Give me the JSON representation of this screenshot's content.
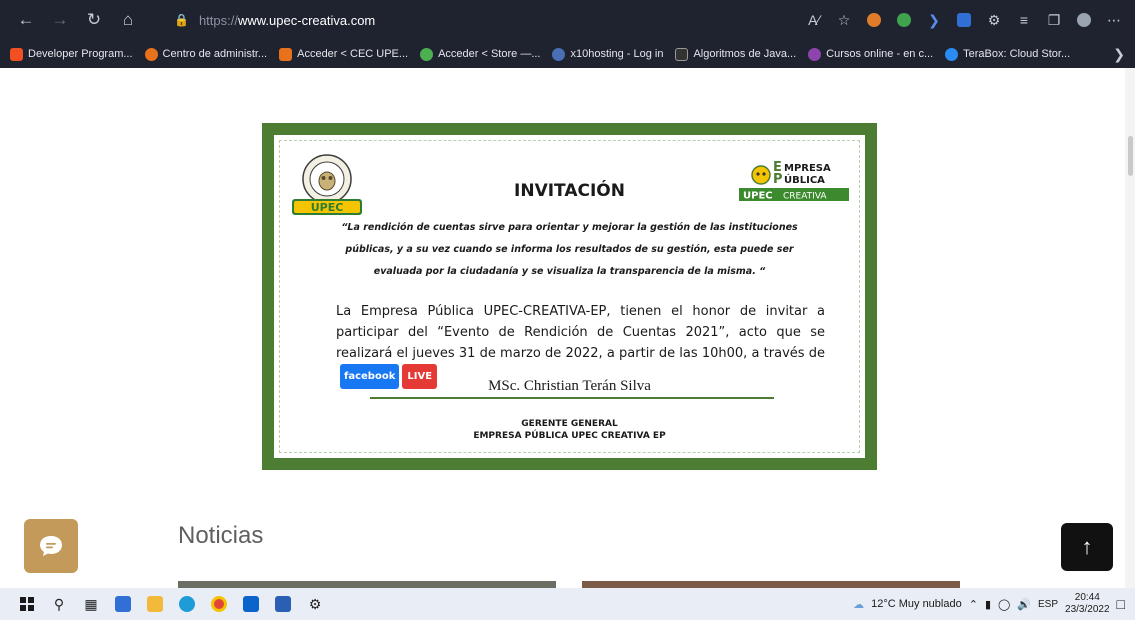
{
  "browser": {
    "url_scheme": "https://",
    "url_host": "www.upec-creativa.com",
    "bookmarks": [
      {
        "label": "Developer Program...",
        "color": "#f25022"
      },
      {
        "label": "Centro de administr...",
        "color": "#e8711c"
      },
      {
        "label": "Acceder < CEC UPE...",
        "color": "#e8711c"
      },
      {
        "label": "Acceder < Store —...",
        "color": "#4caf50"
      },
      {
        "label": "x10hosting - Log in",
        "color": "#4a6fb5"
      },
      {
        "label": "Algoritmos de Java...",
        "color": "#333333"
      },
      {
        "label": "Cursos online - en c...",
        "color": "#8e44ad"
      },
      {
        "label": "TeraBox: Cloud Stor...",
        "color": "#2a8bf2"
      }
    ]
  },
  "invitation": {
    "left_logo_text": "UPEC",
    "right_logo_lines": [
      "MPRESA",
      "ÚBLICA"
    ],
    "right_logo_caps": [
      "E",
      "P"
    ],
    "right_logo_bar": "UPEC",
    "right_logo_bar2": "CREATIVA",
    "title": "INVITACIÓN",
    "quote_lines": [
      "“La rendición de cuentas sirve para orientar y mejorar la gestión de las instituciones",
      "públicas, y a su vez cuando se informa los resultados de su gestión, esta puede ser",
      "evaluada por la ciudadanía y se visualiza la transparencia de la misma. “"
    ],
    "body": "La Empresa Pública UPEC-CREATIVA-EP, tienen el honor de invitar a participar del “Evento de Rendición de Cuentas 2021”, acto que se realizará el jueves 31 de marzo de 2022, a partir de las 10h00, a través de",
    "facebook_label": "facebook",
    "live_label": "LIVE",
    "signer": "MSc. Christian Terán Silva",
    "role_line1": "GERENTE GENERAL",
    "role_line2": "EMPRESA PÚBLICA UPEC CREATIVA EP"
  },
  "section_title": "Noticias",
  "taskbar": {
    "weather": "12°C  Muy nublado",
    "lang": "ESP",
    "time": "20:44",
    "date": "23/3/2022"
  },
  "colors": {
    "frame_green": "#4d7d33",
    "chat_button": "#c49a5a"
  }
}
